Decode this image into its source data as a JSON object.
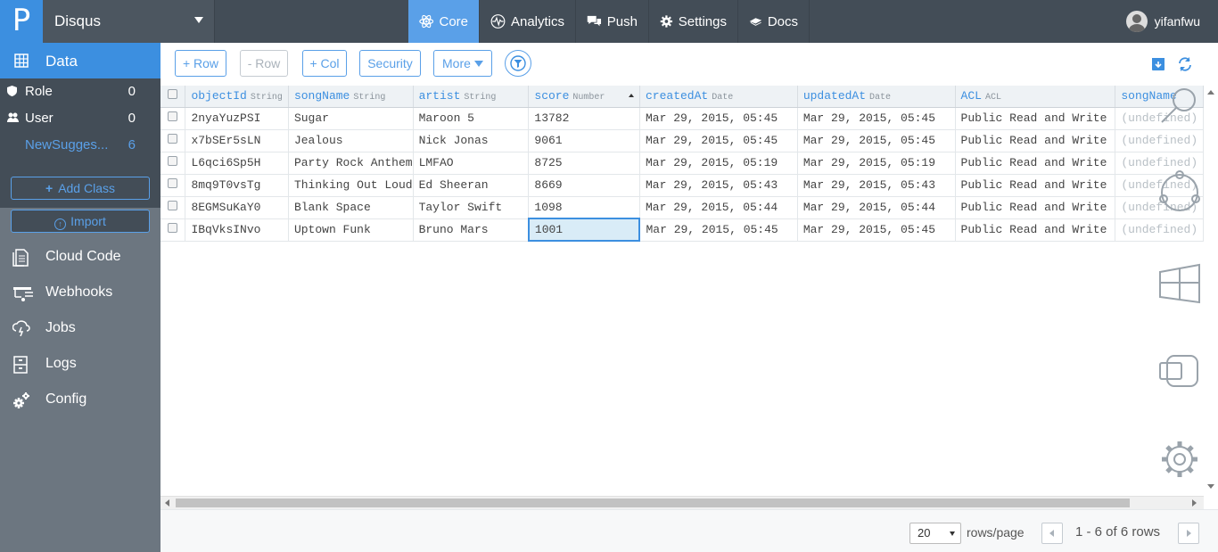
{
  "app": {
    "logo": "P",
    "name": "Disqus"
  },
  "nav": [
    {
      "label": "Core",
      "icon": "atom-icon"
    },
    {
      "label": "Analytics",
      "icon": "pulse-icon"
    },
    {
      "label": "Push",
      "icon": "chat-icon"
    },
    {
      "label": "Settings",
      "icon": "gear-icon"
    },
    {
      "label": "Docs",
      "icon": "book-icon"
    }
  ],
  "user": {
    "name": "yifanfwu"
  },
  "sidebar": {
    "data_label": "Data",
    "classes": [
      {
        "label": "Role",
        "count": "0"
      },
      {
        "label": "User",
        "count": "0"
      },
      {
        "label": "NewSugges...",
        "count": "6"
      }
    ],
    "add_class": "Add Class",
    "import": "Import",
    "links": [
      "Cloud Code",
      "Webhooks",
      "Jobs",
      "Logs",
      "Config"
    ]
  },
  "toolbar": {
    "add_row": "+ Row",
    "remove_row": "- Row",
    "add_col": "+ Col",
    "security": "Security",
    "more": "More"
  },
  "table": {
    "columns": [
      {
        "name": "objectId",
        "type": "String"
      },
      {
        "name": "songName",
        "type": "String"
      },
      {
        "name": "artist",
        "type": "String"
      },
      {
        "name": "score",
        "type": "Number"
      },
      {
        "name": "createdAt",
        "type": "Date"
      },
      {
        "name": "updatedAt",
        "type": "Date"
      },
      {
        "name": "ACL",
        "type": "ACL"
      },
      {
        "name": "songName",
        "type": ""
      }
    ],
    "rows": [
      [
        "2nyaYuzPSI",
        "Sugar",
        "Maroon 5",
        "13782",
        "Mar 29, 2015, 05:45",
        "Mar 29, 2015, 05:45",
        "Public Read and Write",
        "(undefined)"
      ],
      [
        "x7bSEr5sLN",
        "Jealous",
        "Nick Jonas",
        "9061",
        "Mar 29, 2015, 05:45",
        "Mar 29, 2015, 05:45",
        "Public Read and Write",
        "(undefined)"
      ],
      [
        "L6qci6Sp5H",
        "Party Rock Anthem",
        "LMFAO",
        "8725",
        "Mar 29, 2015, 05:19",
        "Mar 29, 2015, 05:19",
        "Public Read and Write",
        "(undefined)"
      ],
      [
        "8mq9T0vsTg",
        "Thinking Out Loud",
        "Ed Sheeran",
        "8669",
        "Mar 29, 2015, 05:43",
        "Mar 29, 2015, 05:43",
        "Public Read and Write",
        "(undefined)"
      ],
      [
        "8EGMSuKaY0",
        "Blank Space",
        "Taylor Swift",
        "1098",
        "Mar 29, 2015, 05:44",
        "Mar 29, 2015, 05:44",
        "Public Read and Write",
        "(undefined)"
      ],
      [
        "IBqVksINvo",
        "Uptown Funk",
        "Bruno Mars",
        "1001",
        "Mar 29, 2015, 05:45",
        "Mar 29, 2015, 05:45",
        "Public Read and Write",
        "(undefined)"
      ]
    ]
  },
  "footer": {
    "page_size": "20",
    "rows_label": "rows/page",
    "range": "1 - 6 of 6 rows"
  }
}
